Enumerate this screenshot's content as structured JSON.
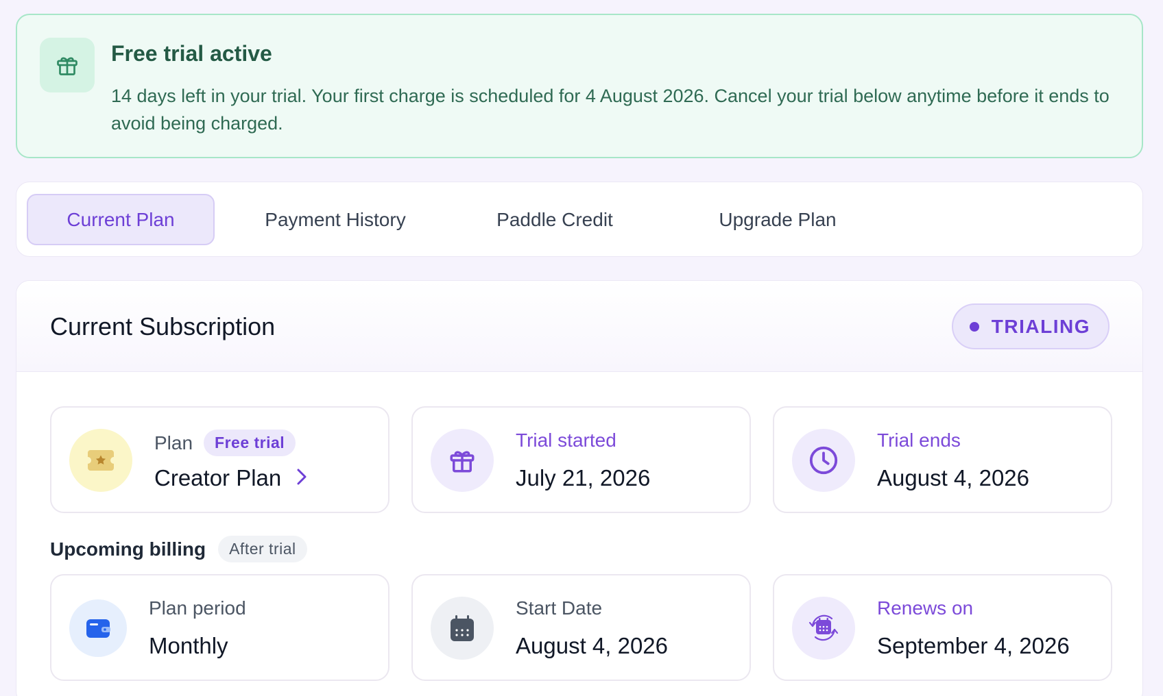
{
  "banner": {
    "title": "Free trial active",
    "message": "14 days left in your trial. Your first charge is scheduled for 4 August 2026. Cancel your trial below anytime before it ends to avoid being charged.",
    "icon": "gift-icon"
  },
  "tabs": [
    {
      "label": "Current Plan",
      "active": true
    },
    {
      "label": "Payment History",
      "active": false
    },
    {
      "label": "Paddle Credit",
      "active": false
    },
    {
      "label": "Upgrade Plan",
      "active": false
    }
  ],
  "subscription": {
    "title": "Current Subscription",
    "status": "TRIALING",
    "plan": {
      "label": "Plan",
      "badge": "Free trial",
      "value": "Creator Plan",
      "icon": "ticket-icon"
    },
    "trial_started": {
      "label": "Trial started",
      "value": "July 21, 2026",
      "icon": "gift-icon"
    },
    "trial_ends": {
      "label": "Trial ends",
      "value": "August 4, 2026",
      "icon": "clock-icon"
    }
  },
  "billing": {
    "title": "Upcoming billing",
    "badge": "After trial",
    "plan_period": {
      "label": "Plan period",
      "value": "Monthly",
      "icon": "wallet-icon"
    },
    "start_date": {
      "label": "Start Date",
      "value": "August 4, 2026",
      "icon": "calendar-icon"
    },
    "renews_on": {
      "label": "Renews on",
      "value": "September 4, 2026",
      "icon": "calendar-renew-icon"
    }
  },
  "colors": {
    "accent": "#6d3fd6",
    "banner_bg": "#effaf5",
    "banner_text": "#245a45",
    "page_bg": "#f6f3fd"
  }
}
